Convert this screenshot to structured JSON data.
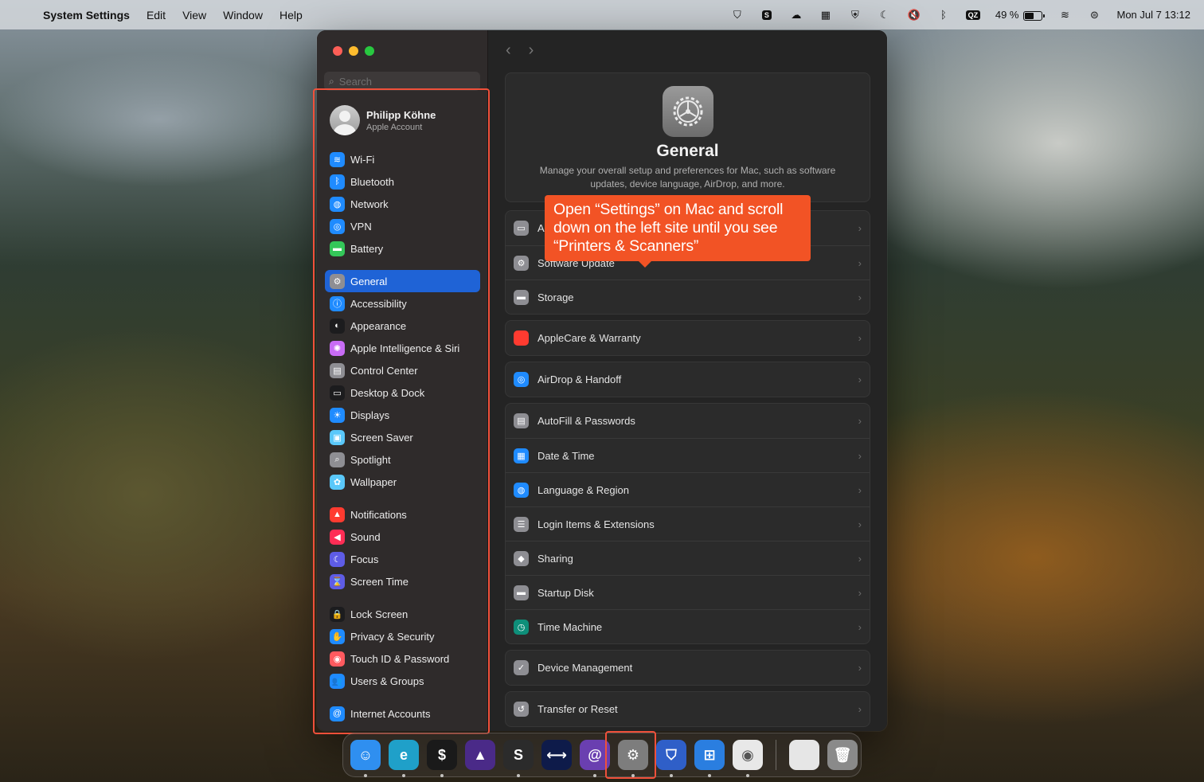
{
  "menubar": {
    "app_name": "System Settings",
    "menus": [
      "Edit",
      "View",
      "Window",
      "Help"
    ],
    "battery_percent": "49 %",
    "battery_level": 0.49,
    "ime_label": "QZ",
    "datetime": "Mon Jul 7  13:12"
  },
  "sidebar": {
    "search_placeholder": "Search",
    "account": {
      "name": "Philipp Köhne",
      "subtitle": "Apple Account"
    },
    "items": [
      {
        "label": "Wi-Fi",
        "color": "#1f8bff",
        "glyph": "≋"
      },
      {
        "label": "Bluetooth",
        "color": "#1f8bff",
        "glyph": "ᛒ"
      },
      {
        "label": "Network",
        "color": "#1f8bff",
        "glyph": "◍"
      },
      {
        "label": "VPN",
        "color": "#1f8bff",
        "glyph": "◎"
      },
      {
        "label": "Battery",
        "color": "#34c759",
        "glyph": "▬"
      },
      {
        "label": "General",
        "color": "#8e8e93",
        "glyph": "⚙"
      },
      {
        "label": "Accessibility",
        "color": "#1f8bff",
        "glyph": "ⓘ"
      },
      {
        "label": "Appearance",
        "color": "#1c1c1e",
        "glyph": "◐"
      },
      {
        "label": "Apple Intelligence & Siri",
        "color": "#c86cf5",
        "glyph": "✺"
      },
      {
        "label": "Control Center",
        "color": "#8e8e93",
        "glyph": "▤"
      },
      {
        "label": "Desktop & Dock",
        "color": "#1c1c1e",
        "glyph": "▭"
      },
      {
        "label": "Displays",
        "color": "#1f8bff",
        "glyph": "☀"
      },
      {
        "label": "Screen Saver",
        "color": "#5ac8fa",
        "glyph": "▣"
      },
      {
        "label": "Spotlight",
        "color": "#8e8e93",
        "glyph": "⌕"
      },
      {
        "label": "Wallpaper",
        "color": "#5ac8fa",
        "glyph": "✿"
      },
      {
        "label": "Notifications",
        "color": "#ff3b30",
        "glyph": "▲"
      },
      {
        "label": "Sound",
        "color": "#ff2d55",
        "glyph": "◀"
      },
      {
        "label": "Focus",
        "color": "#5e5ce6",
        "glyph": "☾"
      },
      {
        "label": "Screen Time",
        "color": "#5e5ce6",
        "glyph": "⌛"
      },
      {
        "label": "Lock Screen",
        "color": "#1c1c1e",
        "glyph": "🔒"
      },
      {
        "label": "Privacy & Security",
        "color": "#1f8bff",
        "glyph": "✋"
      },
      {
        "label": "Touch ID & Password",
        "color": "#ff5a5f",
        "glyph": "◉"
      },
      {
        "label": "Users & Groups",
        "color": "#1f8bff",
        "glyph": "👥"
      },
      {
        "label": "Internet Accounts",
        "color": "#1f8bff",
        "glyph": "@"
      }
    ]
  },
  "main": {
    "title": "General",
    "description": "Manage your overall setup and preferences for Mac, such as software updates, device language, AirDrop, and more.",
    "groups": [
      [
        {
          "label": "About",
          "color": "#8e8e93",
          "glyph": "▭"
        },
        {
          "label": "Software Update",
          "color": "#8e8e93",
          "glyph": "⚙"
        },
        {
          "label": "Storage",
          "color": "#8e8e93",
          "glyph": "▬"
        }
      ],
      [
        {
          "label": "AppleCare & Warranty",
          "color": "#ff3b30",
          "glyph": ""
        }
      ],
      [
        {
          "label": "AirDrop & Handoff",
          "color": "#1f8bff",
          "glyph": "◎"
        }
      ],
      [
        {
          "label": "AutoFill & Passwords",
          "color": "#8e8e93",
          "glyph": "▤"
        },
        {
          "label": "Date & Time",
          "color": "#1f8bff",
          "glyph": "▦"
        },
        {
          "label": "Language & Region",
          "color": "#1f8bff",
          "glyph": "◍"
        },
        {
          "label": "Login Items & Extensions",
          "color": "#8e8e93",
          "glyph": "☰"
        },
        {
          "label": "Sharing",
          "color": "#8e8e93",
          "glyph": "◆"
        },
        {
          "label": "Startup Disk",
          "color": "#8e8e93",
          "glyph": "▬"
        },
        {
          "label": "Time Machine",
          "color": "#0e8f7a",
          "glyph": "◷"
        }
      ],
      [
        {
          "label": "Device Management",
          "color": "#8e8e93",
          "glyph": "✓"
        }
      ],
      [
        {
          "label": "Transfer or Reset",
          "color": "#8e8e93",
          "glyph": "↺"
        }
      ]
    ]
  },
  "callout": {
    "text": "Open “Settings” on Mac and scroll down on the left site until you see “Printers & Scanners”"
  },
  "dock": {
    "items": [
      {
        "name": "finder",
        "color": "#2f8ff0",
        "glyph": "☺"
      },
      {
        "name": "edge",
        "color": "#1fa0c9",
        "glyph": "e"
      },
      {
        "name": "terminal",
        "color": "#1a1a1a",
        "glyph": "$"
      },
      {
        "name": "app-purple",
        "color": "#4a2a88",
        "glyph": "▲"
      },
      {
        "name": "sublime-text",
        "color": "#2b2b2b",
        "glyph": "S"
      },
      {
        "name": "teamviewer",
        "color": "#0e1b4a",
        "glyph": "⟷"
      },
      {
        "name": "app-swirl",
        "color": "#6a3fb0",
        "glyph": "@"
      },
      {
        "name": "system-settings",
        "color": "#7d7d7d",
        "glyph": "⚙"
      },
      {
        "name": "bitwarden",
        "color": "#2f5fc8",
        "glyph": "⛉"
      },
      {
        "name": "windows-app",
        "color": "#2a7ee0",
        "glyph": "⊞"
      },
      {
        "name": "chrome",
        "color": "#e8e8e8",
        "glyph": "◉"
      },
      {
        "name": "document",
        "color": "#e6e6e6",
        "glyph": ""
      },
      {
        "name": "trash",
        "color": "#8a8a8a",
        "glyph": "🗑"
      }
    ]
  }
}
